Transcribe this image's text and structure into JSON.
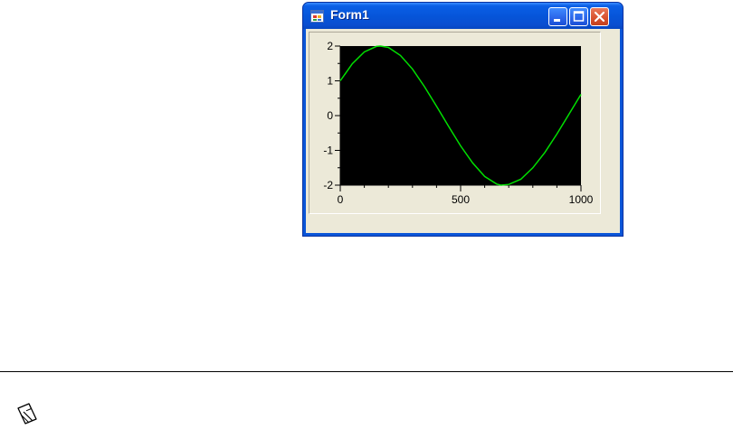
{
  "window": {
    "title": "Form1",
    "app_icon": "form-app-icon",
    "controls": [
      "minimize-icon",
      "maximize-icon",
      "close-icon"
    ]
  },
  "colors": {
    "plot_background": "#000000",
    "trace": "#00e000",
    "titlebar": "#0a5fe6",
    "client_background": "#ece9d8"
  },
  "chart_data": {
    "type": "line",
    "title": "",
    "xlabel": "",
    "ylabel": "",
    "xlim": [
      0,
      1000
    ],
    "ylim": [
      -2,
      2
    ],
    "x_ticks": [
      {
        "value": 0,
        "label": "0"
      },
      {
        "value": 500,
        "label": "500"
      },
      {
        "value": 1000,
        "label": "1000"
      }
    ],
    "y_ticks": [
      {
        "value": 2,
        "label": "2"
      },
      {
        "value": 1,
        "label": "1"
      },
      {
        "value": 0,
        "label": "0"
      },
      {
        "value": -1,
        "label": "-1"
      },
      {
        "value": -2,
        "label": "-2"
      }
    ],
    "grid": false,
    "series": [
      {
        "x": [
          0,
          50,
          100,
          150,
          167,
          200,
          250,
          300,
          350,
          400,
          450,
          500,
          550,
          600,
          650,
          667,
          700,
          750,
          800,
          850,
          900,
          950,
          1000
        ],
        "values": [
          1.0,
          1.49,
          1.83,
          1.99,
          2.0,
          1.96,
          1.73,
          1.34,
          0.83,
          0.27,
          -0.31,
          -0.87,
          -1.36,
          -1.75,
          -1.97,
          -2.0,
          -1.98,
          -1.83,
          -1.5,
          -1.06,
          -0.53,
          0.04,
          0.61
        ]
      }
    ]
  },
  "note": {
    "icon": "note-pencil-icon"
  }
}
